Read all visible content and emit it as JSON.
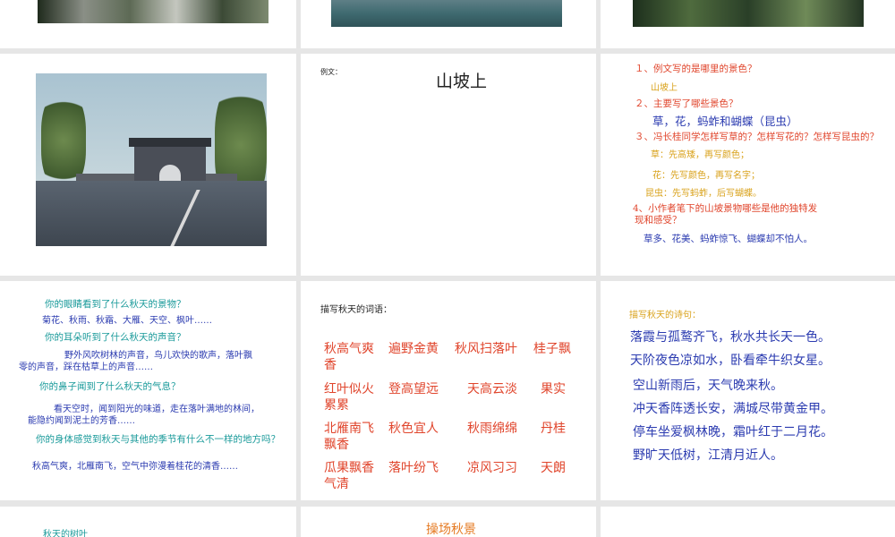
{
  "slide_c2r1": {
    "prefix": "例文：",
    "title": "山坡上"
  },
  "slide_c3r1": {
    "q1": "１、例文写的是哪里的景色？",
    "a1": "山坡上",
    "q2": "２、主要写了哪些景色？",
    "a2": "草，花，蚂蚱和蝴蝶（昆虫）",
    "q3": "３、冯长桂同学怎样写草的？怎样写花的？怎样写昆虫的？",
    "a3_1": "草：先高矮，再写颜色；",
    "a3_2": "花：先写颜色，再写名字；",
    "a3_3": "昆虫：先写蚂蚱，后写蝴蝶。",
    "q4_line1": "4、小作者笔下的山坡景物哪些是他的独特发",
    "q4_line2": "现和感受？",
    "a4": "草多、花美、蚂蚱惊飞、蝴蝶却不怕人。"
  },
  "slide_c1r2": {
    "q1": "你的眼睛看到了什么秋天的景物？",
    "a1": "菊花、秋雨、秋霜、大雁、天空、枫叶……",
    "q2": "你的耳朵听到了什么秋天的声音？",
    "a2_line1": "野外风吹树林的声音，鸟儿欢快的歌声，落叶飘",
    "a2_line2": "零的声音，踩在枯草上的声音……",
    "q3": "你的鼻子闻到了什么秋天的气息？",
    "a3_line1": "看天空时，闻到阳光的味道，走在落叶满地的林间，",
    "a3_line2": "能隐约闻到泥土的芳香……",
    "q4": "你的身体感觉到秋天与其他的季节有什么不一样的地方吗？",
    "a4": "秋高气爽，北雁南飞，空气中弥漫着桂花的清香……"
  },
  "slide_c2r2": {
    "heading": "描写秋天的词语：",
    "rows": [
      {
        "a": "秋高气爽",
        "b": "遍野金黄",
        "c": "秋风扫落叶",
        "d": "桂子飘",
        "wrap": "香"
      },
      {
        "a": "红叶似火",
        "b": "登高望远",
        "c": "天高云淡",
        "d": "果实",
        "wrap": "累累"
      },
      {
        "a": "北雁南飞",
        "b": "秋色宜人",
        "c": "秋雨绵绵",
        "d": "丹桂",
        "wrap": "飘香"
      },
      {
        "a": "瓜果飘香",
        "b": "落叶纷飞",
        "c": "凉风习习",
        "d": "天朗",
        "wrap": "气清"
      }
    ]
  },
  "slide_c3r2": {
    "heading": "描写秋天的诗句：",
    "lines": [
      "落霞与孤鹜齐飞，秋水共长天一色。",
      "天阶夜色凉如水，卧看牵牛织女星。",
      "空山新雨后，天气晚来秋。",
      "冲天香阵透长安，满城尽带黄金甲。",
      "停车坐爱枫林晚，霜叶红于二月花。",
      "野旷天低树，江清月近人。"
    ]
  },
  "slide_c1r3": {
    "title": "秋天的树叶"
  },
  "slide_c2r3": {
    "title": "操场秋景"
  }
}
